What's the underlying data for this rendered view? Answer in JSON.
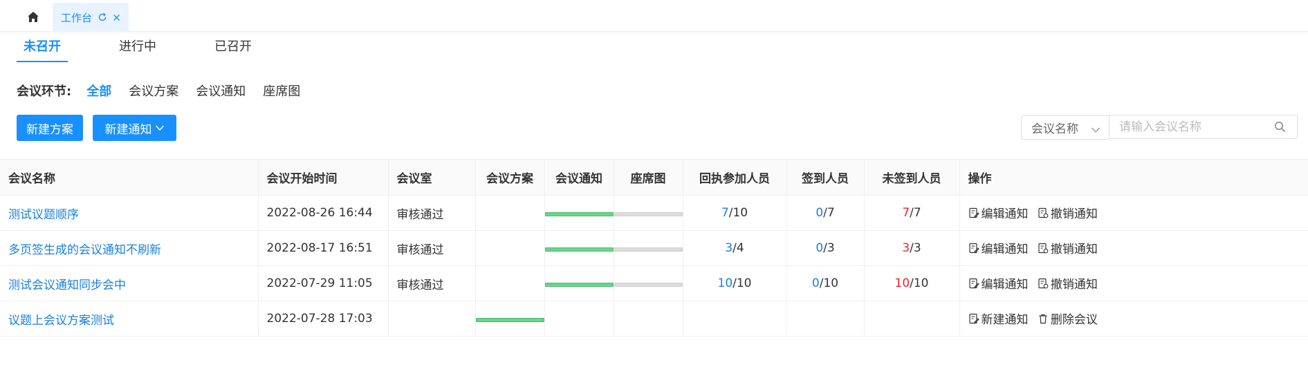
{
  "topbar": {
    "tab_label": "工作台"
  },
  "status_tabs": [
    {
      "label": "未召开",
      "active": true
    },
    {
      "label": "进行中",
      "active": false
    },
    {
      "label": "已召开",
      "active": false
    }
  ],
  "filter": {
    "label": "会议环节:",
    "options": [
      "全部",
      "会议方案",
      "会议通知",
      "座席图"
    ]
  },
  "buttons": {
    "new_plan": "新建方案",
    "new_notice": "新建通知"
  },
  "search": {
    "select_value": "会议名称",
    "placeholder": "请输入会议名称"
  },
  "table": {
    "headers": [
      "会议名称",
      "会议开始时间",
      "会议室",
      "会议方案",
      "会议通知",
      "座席图",
      "回执参加人员",
      "签到人员",
      "未签到人员",
      "操作"
    ],
    "rows": [
      {
        "name": "测试议题顺序",
        "start_time": "2022-08-26 16:44",
        "room": "审核通过",
        "receipt_done": "7",
        "receipt_total": "/10",
        "signed_done": "0",
        "signed_total": "/7",
        "unsigned_done": "7",
        "unsigned_total": "/7",
        "op1": "编辑通知",
        "op2": "撤销通知"
      },
      {
        "name": "多页签生成的会议通知不刷新",
        "start_time": "2022-08-17 16:51",
        "room": "审核通过",
        "receipt_done": "3",
        "receipt_total": "/4",
        "signed_done": "0",
        "signed_total": "/3",
        "unsigned_done": "3",
        "unsigned_total": "/3",
        "op1": "编辑通知",
        "op2": "撤销通知"
      },
      {
        "name": "测试会议通知同步会中",
        "start_time": "2022-07-29 11:05",
        "room": "审核通过",
        "receipt_done": "10",
        "receipt_total": "/10",
        "signed_done": "0",
        "signed_total": "/10",
        "unsigned_done": "10",
        "unsigned_total": "/10",
        "op1": "编辑通知",
        "op2": "撤销通知"
      },
      {
        "name": "议题上会议方案测试",
        "start_time": "2022-07-28 17:03",
        "room": "",
        "receipt_done": "",
        "receipt_total": "",
        "signed_done": "",
        "signed_total": "",
        "unsigned_done": "",
        "unsigned_total": "",
        "op1": "新建通知",
        "op2": "删除会议"
      }
    ]
  },
  "colors": {
    "primary": "#1890ff",
    "link": "#1a7fe0",
    "danger": "#f5222d",
    "progress_done": "#6bd58b",
    "progress_pending": "#dcdcdc"
  }
}
